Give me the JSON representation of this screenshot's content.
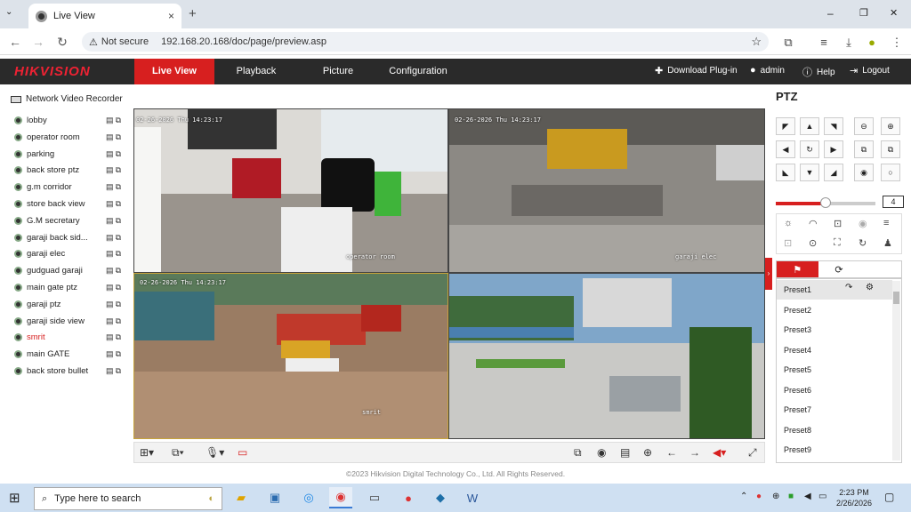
{
  "browser": {
    "tab_title": "Live View",
    "new_tab": "+",
    "close_tab": "×",
    "security": "Not secure",
    "url": "192.168.20.168/doc/page/preview.asp",
    "win_min": "–",
    "win_max": "❐",
    "win_close": "✕"
  },
  "app": {
    "logo": "HIKVISION",
    "nav": [
      "Live View",
      "Playback",
      "Picture",
      "Configuration"
    ],
    "download": "Download Plug-in",
    "user": "admin",
    "help": "Help",
    "logout": "Logout"
  },
  "left": {
    "title": "Network Video Recorder",
    "cameras": [
      {
        "name": "lobby",
        "color": "#222"
      },
      {
        "name": "operator room",
        "color": "#222"
      },
      {
        "name": "parking",
        "color": "#222"
      },
      {
        "name": "back store ptz",
        "color": "#222"
      },
      {
        "name": "g.m corridor",
        "color": "#222"
      },
      {
        "name": "store back view",
        "color": "#222"
      },
      {
        "name": "G.M secretary",
        "color": "#222"
      },
      {
        "name": "garaji back sid...",
        "color": "#222"
      },
      {
        "name": "garaji elec",
        "color": "#222"
      },
      {
        "name": "gudguad garaji",
        "color": "#222"
      },
      {
        "name": "main gate ptz",
        "color": "#222"
      },
      {
        "name": "garaji ptz",
        "color": "#222"
      },
      {
        "name": "garaji side view",
        "color": "#222"
      },
      {
        "name": "smrit",
        "color": "#d71f1f"
      },
      {
        "name": "main GATE",
        "color": "#222"
      },
      {
        "name": "back store bullet",
        "color": "#222"
      }
    ]
  },
  "video": {
    "cells": [
      {
        "stamp": "02-26-2026 Thu 14:23:17",
        "label": "operator room"
      },
      {
        "stamp": "02-26-2026 Thu 14:23:17",
        "label": "garaji elec"
      },
      {
        "stamp": "02-26-2026 Thu 14:23:17",
        "label": "smrit"
      },
      {
        "stamp": "",
        "label": ""
      }
    ]
  },
  "footer": {
    "copyright": "©2023 Hikvision Digital Technology Co., Ltd. All Rights Reserved."
  },
  "ptz": {
    "title": "PTZ",
    "speed": "4",
    "speed_level_fraction": 0.5,
    "presets": [
      "Preset1",
      "Preset2",
      "Preset3",
      "Preset4",
      "Preset5",
      "Preset6",
      "Preset7",
      "Preset8",
      "Preset9"
    ]
  },
  "taskbar": {
    "search_placeholder": "Type here to search",
    "time": "2:23 PM",
    "date": "2/26/2026"
  },
  "colors": {
    "accent": "#d71f1f",
    "header": "#2a2a2a"
  }
}
